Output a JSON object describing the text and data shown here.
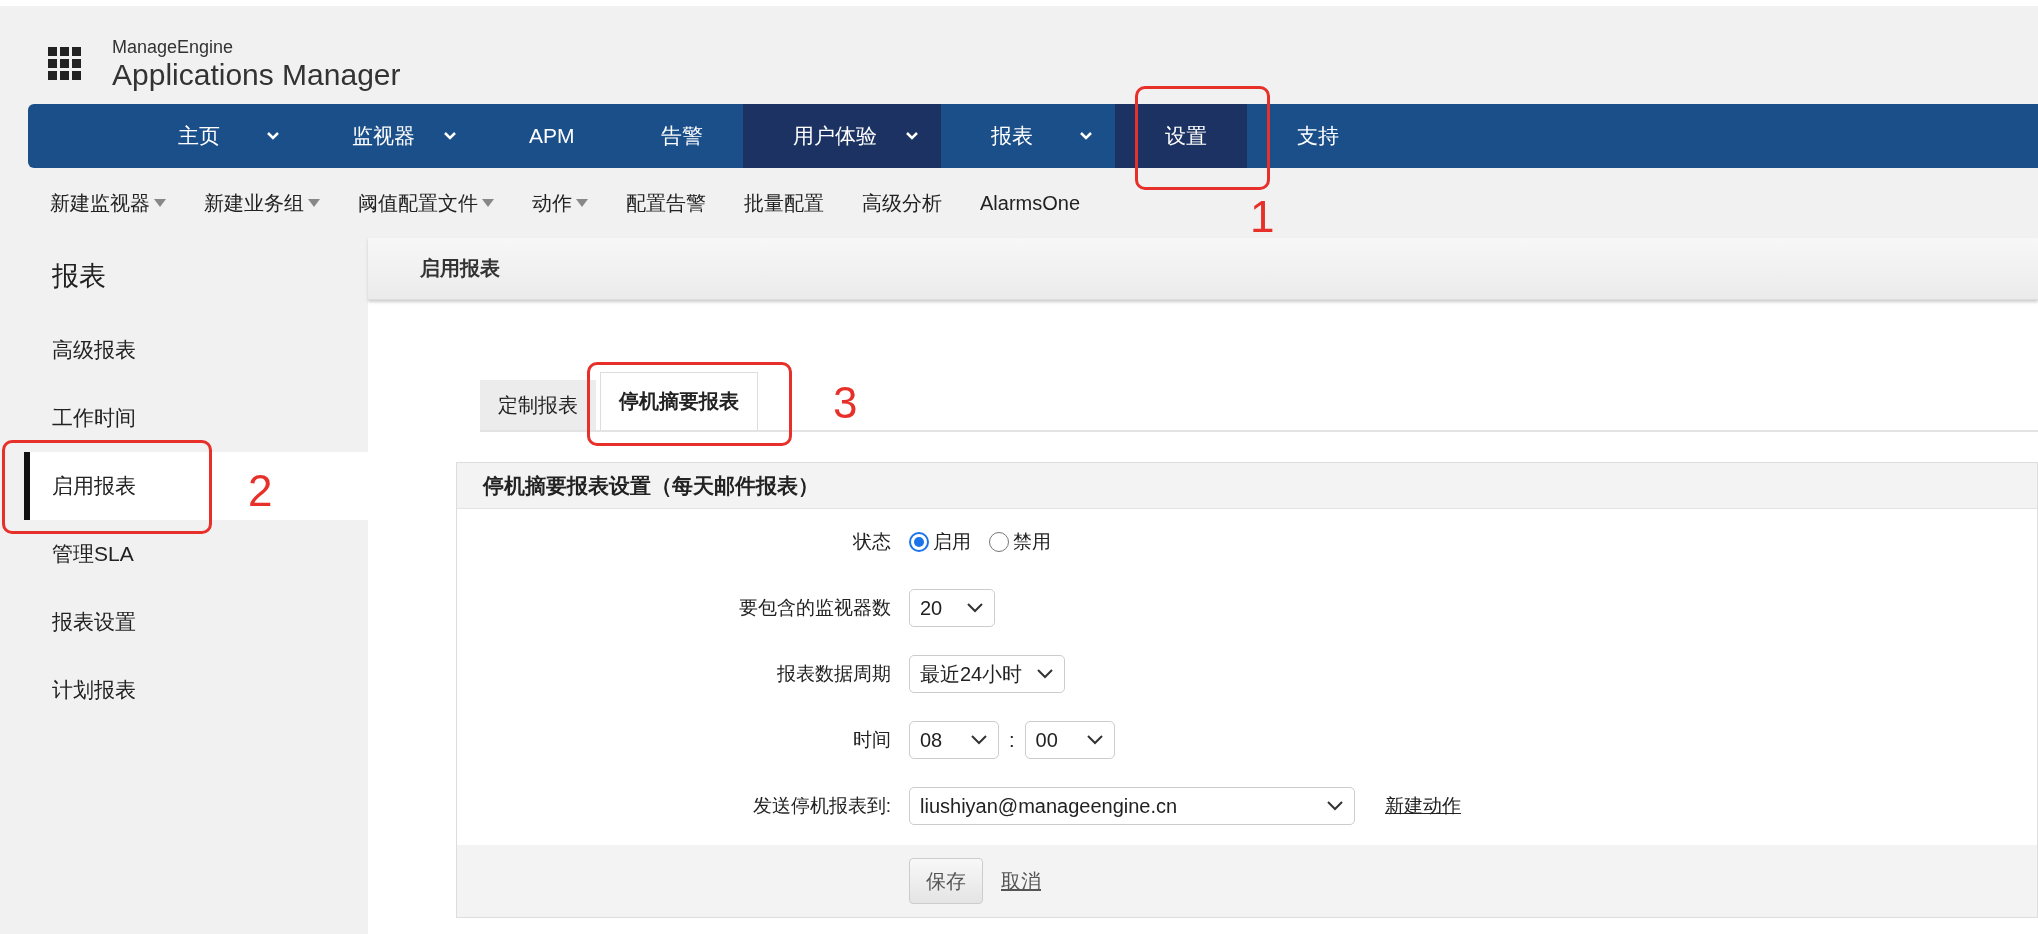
{
  "header": {
    "brand": "ManageEngine",
    "product": "Applications Manager"
  },
  "nav": [
    {
      "label": "主页",
      "caret": true,
      "selected": false
    },
    {
      "label": "监视器",
      "caret": true,
      "selected": false
    },
    {
      "label": "APM",
      "caret": false,
      "selected": false
    },
    {
      "label": "告警",
      "caret": false,
      "selected": false
    },
    {
      "label": "用户体验",
      "caret": true,
      "selected": true
    },
    {
      "label": "报表",
      "caret": true,
      "selected": false
    },
    {
      "label": "设置",
      "caret": false,
      "selected": true
    },
    {
      "label": "支持",
      "caret": false,
      "selected": false
    }
  ],
  "subnav": [
    {
      "label": "新建监视器",
      "caret": true
    },
    {
      "label": "新建业务组",
      "caret": true
    },
    {
      "label": "阈值配置文件",
      "caret": true
    },
    {
      "label": "动作",
      "caret": true
    },
    {
      "label": "配置告警",
      "caret": false
    },
    {
      "label": "批量配置",
      "caret": false
    },
    {
      "label": "高级分析",
      "caret": false
    },
    {
      "label": "AlarmsOne",
      "caret": false
    }
  ],
  "sidebar": {
    "title": "报表",
    "items": [
      {
        "label": "高级报表",
        "selected": false
      },
      {
        "label": "工作时间",
        "selected": false
      },
      {
        "label": "启用报表",
        "selected": true
      },
      {
        "label": "管理SLA",
        "selected": false
      },
      {
        "label": "报表设置",
        "selected": false
      },
      {
        "label": "计划报表",
        "selected": false
      }
    ]
  },
  "panel": {
    "title": "启用报表",
    "tabs": [
      {
        "label": "定制报表",
        "selected": false
      },
      {
        "label": "停机摘要报表",
        "selected": true
      }
    ],
    "form": {
      "title": "停机摘要报表设置（每天邮件报表）",
      "rows": [
        {
          "kind": "radio",
          "label": "状态",
          "options": [
            {
              "label": "启用",
              "selected": true
            },
            {
              "label": "禁用",
              "selected": false
            }
          ]
        },
        {
          "kind": "select",
          "label": "要包含的监视器数",
          "selects": [
            "20"
          ]
        },
        {
          "kind": "select",
          "label": "报表数据周期",
          "selects": [
            "最近24小时"
          ]
        },
        {
          "kind": "time",
          "label": "时间",
          "selects": [
            "08",
            "00"
          ],
          "separator": ":"
        },
        {
          "kind": "email",
          "label": "发送停机报表到:",
          "selects": [
            "liushiyan@manageengine.cn"
          ],
          "link": "新建动作"
        }
      ],
      "buttons": {
        "save": "保存",
        "cancel": "取消"
      }
    }
  },
  "annotations": [
    {
      "number": "1"
    },
    {
      "number": "2"
    },
    {
      "number": "3"
    }
  ]
}
